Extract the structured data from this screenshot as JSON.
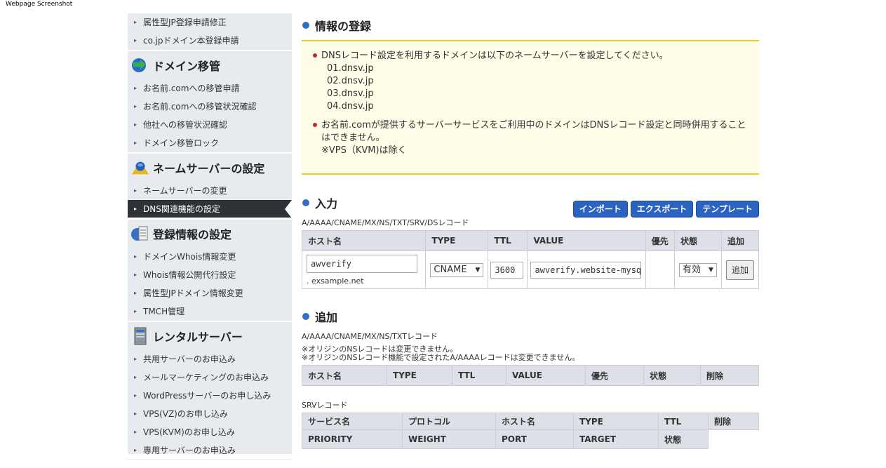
{
  "watermark": "Webpage Screenshot",
  "sidebar": {
    "top_items": [
      "属性型JP登録申請修正",
      "co.jpドメイン本登録申請"
    ],
    "sections": [
      {
        "title": "ドメイン移管",
        "icon": "transfer-icon",
        "items": [
          "お名前.comへの移管申請",
          "お名前.comへの移管状況確認",
          "他社への移管状況確認",
          "ドメイン移管ロック"
        ]
      },
      {
        "title": "ネームサーバーの設定",
        "icon": "nameserver-icon",
        "items": [
          "ネームサーバーの変更",
          "DNS関連機能の設定"
        ],
        "active": 1
      },
      {
        "title": "登録情報の設定",
        "icon": "document-icon",
        "items": [
          "ドメインWhois情報変更",
          "Whois情報公開代行設定",
          "属性型JPドメイン情報変更",
          "TMCH管理"
        ]
      },
      {
        "title": "レンタルサーバー",
        "icon": "server-icon",
        "items": [
          "共用サーバーのお申込み",
          "メールマーケティングのお申込み",
          "WordPressサーバーのお申し込み",
          "VPS(VZ)のお申し込み",
          "VPS(KVM)のお申し込み",
          "専用サーバーのお申込み"
        ]
      }
    ]
  },
  "info": {
    "title": "情報の登録",
    "notice1": "DNSレコード設定を利用するドメインは以下のネームサーバーを設定してください。",
    "nameservers": [
      "01.dnsv.jp",
      "02.dnsv.jp",
      "03.dnsv.jp",
      "04.dnsv.jp"
    ],
    "notice2a": "お名前.comが提供するサーバーサービスをご利用中のドメインはDNSレコード設定と同時併用すること",
    "notice2b": "はできません。",
    "notice2c": "※VPS（KVM)は除く"
  },
  "input": {
    "title": "入力",
    "buttons": {
      "import": "インポート",
      "export": "エクスポート",
      "template": "テンプレート"
    },
    "caption": "A/AAAA/CNAME/MX/NS/TXT/SRV/DSレコード",
    "headers": [
      "ホスト名",
      "TYPE",
      "TTL",
      "VALUE",
      "優先",
      "状態",
      "追加"
    ],
    "host_value": "awverify",
    "domain_suffix": ". exsample.net",
    "type_value": "CNAME",
    "ttl_value": "3600",
    "value_value": "awverify.website-mysql.azu",
    "status_value": "有効",
    "add_button": "追加"
  },
  "add": {
    "title": "追加",
    "caption": "A/AAAA/CNAME/MX/NS/TXTレコード",
    "note1": "※オリジンのNSレコードは変更できません。",
    "note2": "※オリジンのNSレコード機能で設定されたA/AAAAレコードは変更できません。",
    "headers": [
      "ホスト名",
      "TYPE",
      "TTL",
      "VALUE",
      "優先",
      "状態",
      "削除"
    ],
    "srv_caption": "SRVレコード",
    "srv_row1": [
      "サービス名",
      "プロトコル",
      "ホスト名",
      "TYPE",
      "TTL"
    ],
    "srv_delete": "削除",
    "srv_row2": [
      "PRIORITY",
      "WEIGHT",
      "PORT",
      "TARGET",
      "状態"
    ]
  }
}
